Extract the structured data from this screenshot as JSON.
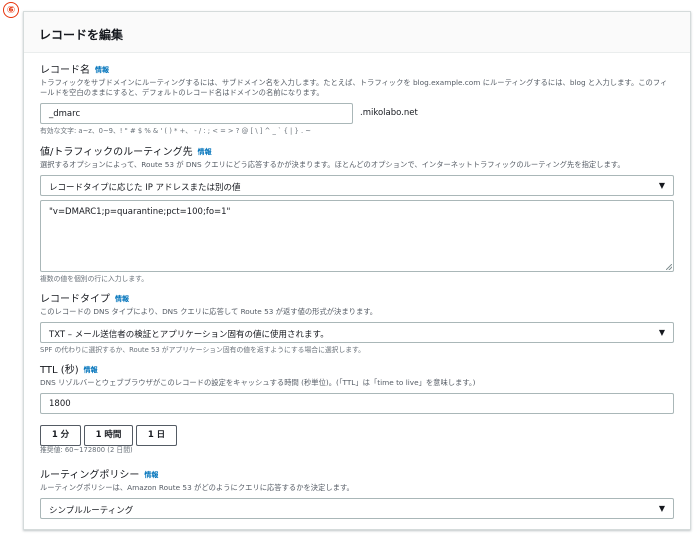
{
  "step_badge": "⑥",
  "panel": {
    "title": "レコードを編集"
  },
  "record_name": {
    "label": "レコード名",
    "info": "情報",
    "description": "トラフィックをサブドメインにルーティングするには、サブドメイン名を入力します。たとえば、トラフィックを blog.example.com にルーティングするには、blog と入力します。このフィールドを空白のままにすると、デフォルトのレコード名はドメインの名前になります。",
    "value": "_dmarc",
    "suffix": ".mikolabo.net",
    "allowed_chars": "有効な文字: a~z、0~9、! \" # $ % & ' ( ) * +、 - / : ; < = > ? @ [ \\ ] ^ _ ` { | } . ~"
  },
  "routing_target": {
    "label": "値/トラフィックのルーティング先",
    "info": "情報",
    "description": "選択するオプションによって、Route 53 が DNS クエリにどう応答するかが決まります。ほとんどのオプションで、インターネットトラフィックのルーティング先を指定します。",
    "selected": "レコードタイプに応じた IP アドレスまたは別の値",
    "value": "\"v=DMARC1;p=quarantine;pct=100;fo=1\"",
    "hint": "複数の値を個別の行に入力します。"
  },
  "record_type": {
    "label": "レコードタイプ",
    "info": "情報",
    "description": "このレコードの DNS タイプにより、DNS クエリに応答して Route 53 が返す値の形式が決まります。",
    "selected": "TXT – メール送信者の検証とアプリケーション固有の値に使用されます。",
    "hint": "SPF の代わりに選択するか、Route 53 がアプリケーション固有の値を返すようにする場合に選択します。"
  },
  "ttl": {
    "label": "TTL (秒)",
    "info": "情報",
    "description": "DNS リゾルバーとウェブブラウザがこのレコードの設定をキャッシュする時間 (秒単位)。(「TTL」は「time to live」を意味します。)",
    "value": "1800",
    "buttons": [
      "1 分",
      "1 時間",
      "1 日"
    ],
    "hint": "推奨値: 60~172800 (2 日間)"
  },
  "routing_policy": {
    "label": "ルーティングポリシー",
    "info": "情報",
    "description": "ルーティングポリシーは、Amazon Route 53 がどのようにクエリに応答するかを決定します。",
    "selected": "シンプルルーティング"
  }
}
